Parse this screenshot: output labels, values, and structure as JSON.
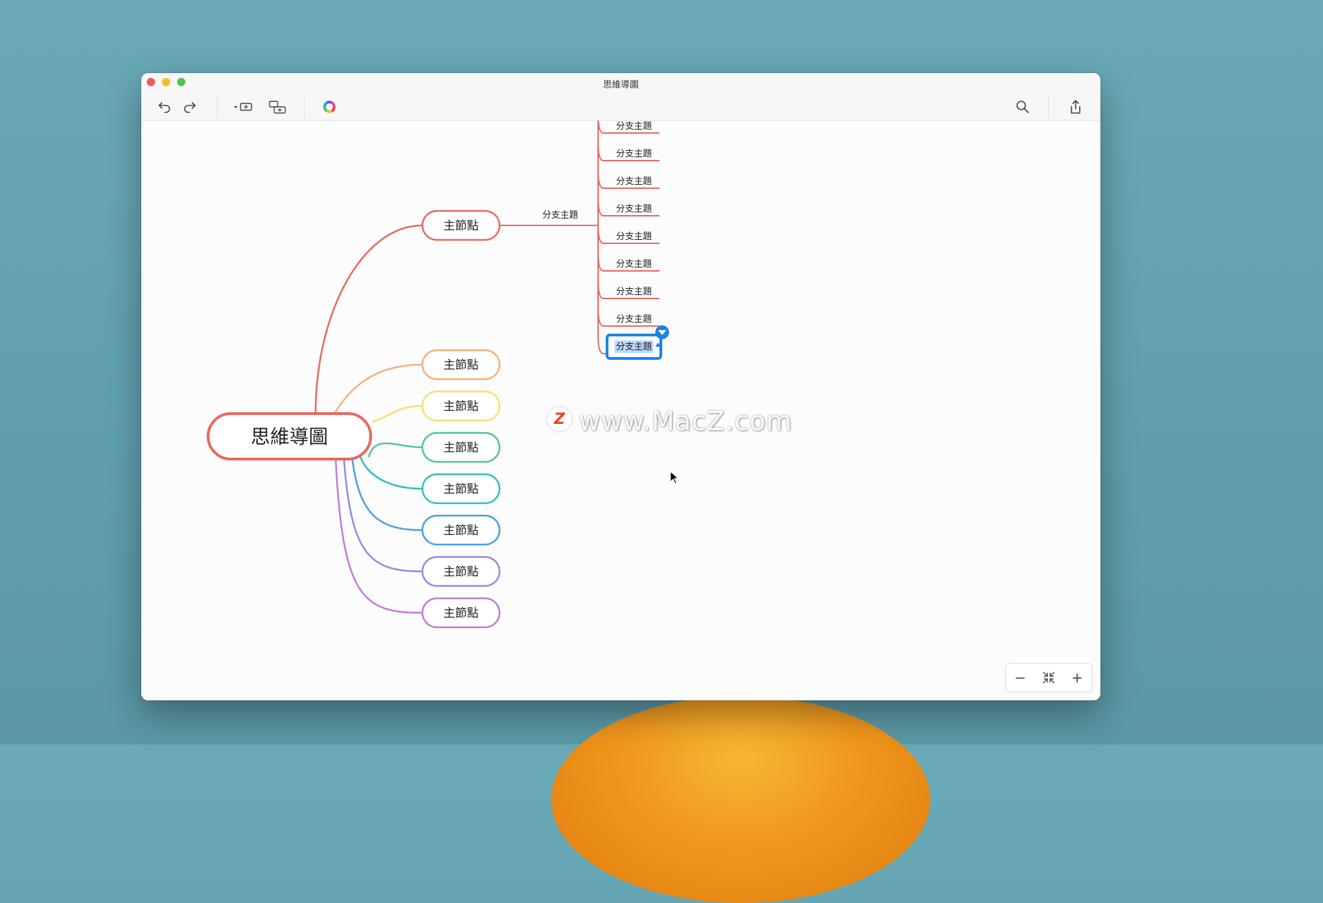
{
  "window": {
    "title": "思維導圖"
  },
  "toolbar": {
    "undo_icon": "undo-icon",
    "redo_icon": "redo-icon",
    "insert_sibling_icon": "insert-sibling-icon",
    "insert_child_icon": "insert-child-icon",
    "theme_icon": "color-wheel-icon",
    "search_icon": "search-icon",
    "share_icon": "share-icon"
  },
  "mindmap": {
    "root": "思維導圖",
    "main_nodes": [
      "主節點",
      "主節點",
      "主節點",
      "主節點",
      "主節點",
      "主節點",
      "主節點",
      "主節點"
    ],
    "main_colors": [
      "#e9685f",
      "#f2b07b",
      "#f5e06e",
      "#4fc78e",
      "#2fbfbf",
      "#4a9ee0",
      "#9a86de",
      "#c27ad9"
    ],
    "first_branch_label": "分支主題",
    "sub_branches": [
      "分支主題",
      "分支主題",
      "分支主題",
      "分支主題",
      "分支主題",
      "分支主題",
      "分支主題",
      "分支主題",
      "分支主題"
    ],
    "selected_index": 8,
    "selection_color": "#1a84e8"
  },
  "watermark": {
    "badge": "Z",
    "text": "www.MacZ.com"
  },
  "zoom": {
    "minus": "−",
    "plus": "+"
  }
}
